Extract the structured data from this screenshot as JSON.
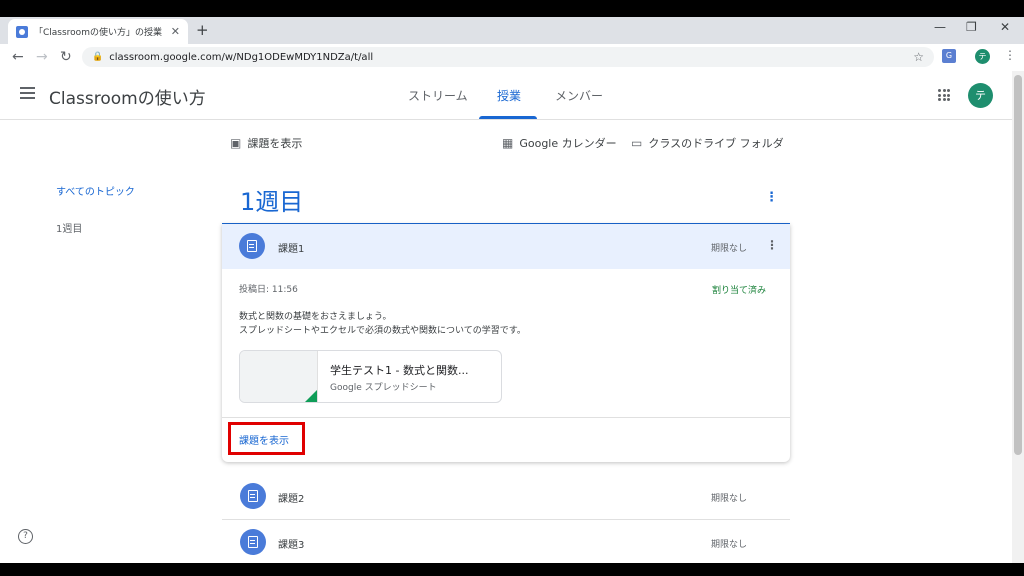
{
  "browser": {
    "tab_title": "「Classroomの使い方」の授業",
    "tab_close": "✕",
    "new_tab": "+",
    "url": "classroom.google.com/w/NDg1ODEwMDY1NDZa/t/all",
    "profile_initial": "テ"
  },
  "header": {
    "title": "Classroomの使い方",
    "tabs": [
      "ストリーム",
      "授業",
      "メンバー"
    ],
    "active_tab": "授業",
    "avatar_initial": "テ"
  },
  "toolbar": {
    "view_assignments": "課題を表示",
    "calendar": "Google カレンダー",
    "drive_folder": "クラスのドライブ フォルダ"
  },
  "sidebar": {
    "items": [
      "すべてのトピック",
      "1週目"
    ]
  },
  "topic": {
    "title": "1週目"
  },
  "assignments": [
    {
      "title": "課題1",
      "due": "期限なし",
      "posted": "投稿日: 11:56",
      "status": "割り当て済み",
      "description_line1": "数式と関数の基礎をおさえましょう。",
      "description_line2": "スプレッドシートやエクセルで必須の数式や関数についての学習です。",
      "attachment_title": "学生テスト1 - 数式と関数...",
      "attachment_type": "Google スプレッドシート",
      "view_button": "課題を表示"
    },
    {
      "title": "課題2",
      "due": "期限なし"
    },
    {
      "title": "課題3",
      "due": "期限なし"
    }
  ],
  "help": "?",
  "colors": {
    "accent": "#1967d2",
    "assigned_green": "#188038",
    "highlight_red": "#e00000",
    "avatar_green": "#1e8e6e"
  }
}
